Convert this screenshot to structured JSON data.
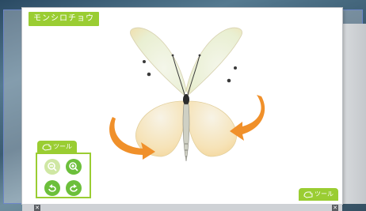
{
  "title": "モンシロチョウ",
  "tool_left": {
    "label": "ツール"
  },
  "tool_right": {
    "label": "ツール"
  },
  "buttons": {
    "zoom_out": "zoom-out-icon",
    "zoom_in": "zoom-in-icon",
    "rotate_left": "rotate-left-icon",
    "rotate_right": "rotate-right-icon"
  },
  "colors": {
    "accent": "#9acd32",
    "accent_dark": "#6cbf3b",
    "arrow": "#f0902a",
    "frame": "#6d86c8"
  }
}
